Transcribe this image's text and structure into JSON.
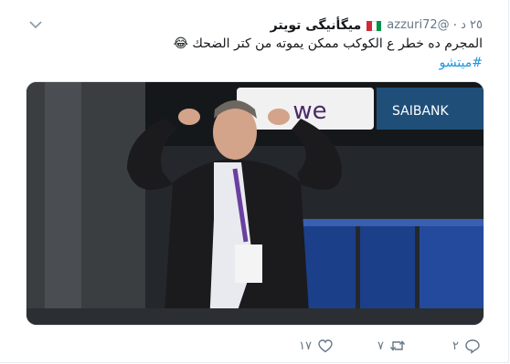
{
  "tweet": {
    "display_name": "ميگأنيگى تويتر",
    "handle": "@azzuri72",
    "time": "٢٥ د",
    "text": "المجرم ده خطر ع الكوكب ممكن يموته من كتر الضحك 😂",
    "hashtag": "#ميتشو",
    "flag_colors": [
      "#009246",
      "#ffffff",
      "#ce2b37"
    ],
    "media": {
      "banner_left": "we",
      "banner_right": "SAIBANK"
    }
  },
  "actions": {
    "reply_count": "٢",
    "retweet_count": "٧",
    "like_count": "١٧"
  },
  "colors": {
    "hashtag": "#1b95e0",
    "muted": "#657786"
  }
}
